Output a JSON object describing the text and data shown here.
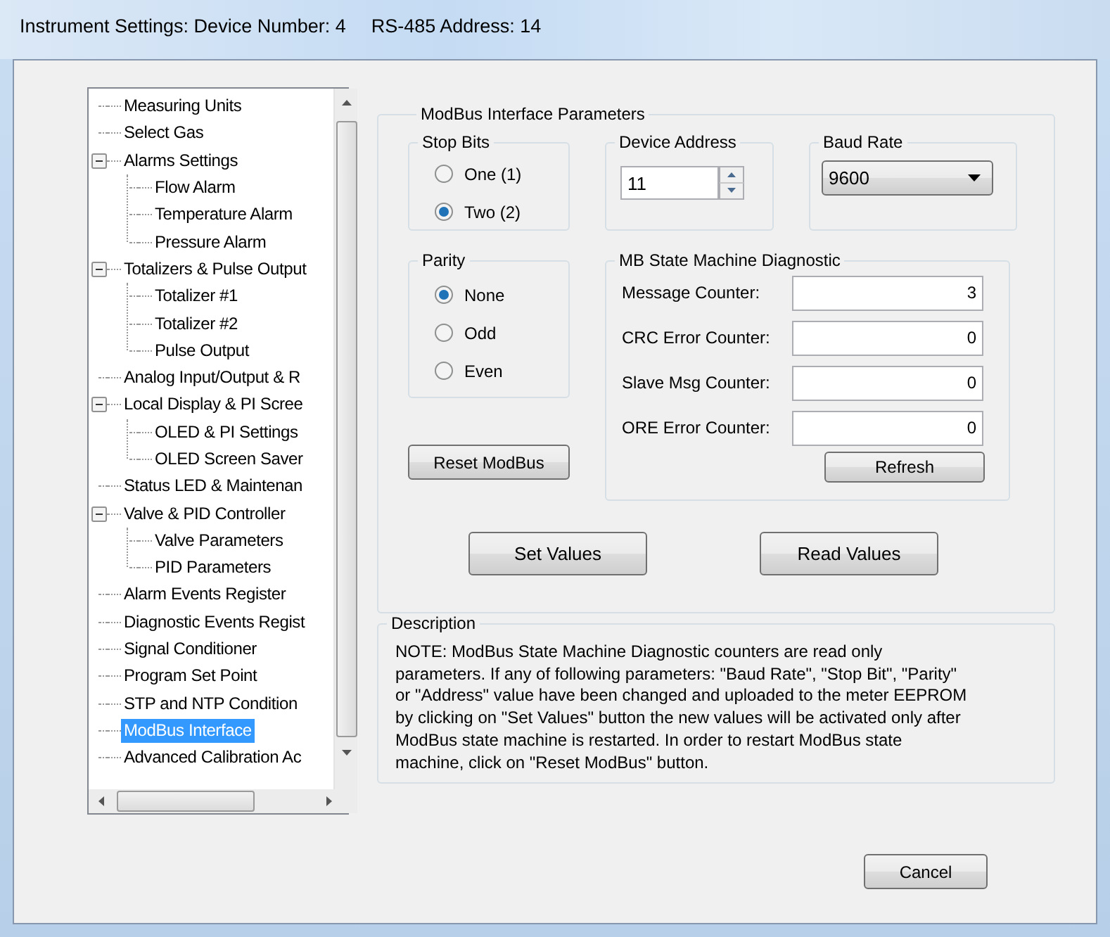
{
  "window": {
    "title_parts": [
      "Instrument Settings: Device Number: 4",
      "RS-485 Address: 14"
    ]
  },
  "tree": [
    {
      "label": "Measuring Units",
      "selected": false
    },
    {
      "label": "Select Gas",
      "selected": false
    },
    {
      "label": "Alarms Settings",
      "selected": false,
      "expanded": true,
      "children": [
        {
          "label": "Flow Alarm",
          "selected": false
        },
        {
          "label": "Temperature Alarm",
          "selected": false
        },
        {
          "label": "Pressure Alarm",
          "selected": false
        }
      ]
    },
    {
      "label": "Totalizers & Pulse Output",
      "selected": false,
      "expanded": true,
      "children": [
        {
          "label": "Totalizer #1",
          "selected": false
        },
        {
          "label": "Totalizer #2",
          "selected": false
        },
        {
          "label": "Pulse Output",
          "selected": false
        }
      ]
    },
    {
      "label": "Analog Input/Output & R",
      "selected": false
    },
    {
      "label": "Local Display & PI Scree",
      "selected": false,
      "expanded": true,
      "children": [
        {
          "label": "OLED & PI Settings",
          "selected": false
        },
        {
          "label": "OLED Screen Saver",
          "selected": false
        }
      ]
    },
    {
      "label": "Status LED & Maintenan",
      "selected": false
    },
    {
      "label": "Valve & PID Controller",
      "selected": false,
      "expanded": true,
      "children": [
        {
          "label": "Valve Parameters",
          "selected": false
        },
        {
          "label": "PID Parameters",
          "selected": false
        }
      ]
    },
    {
      "label": "Alarm Events Register",
      "selected": false
    },
    {
      "label": "Diagnostic Events Regist",
      "selected": false
    },
    {
      "label": "Signal Conditioner",
      "selected": false
    },
    {
      "label": "Program Set Point",
      "selected": false
    },
    {
      "label": "STP and NTP Condition",
      "selected": false
    },
    {
      "label": "ModBus Interface",
      "selected": true
    },
    {
      "label": "Advanced Calibration Ac",
      "selected": false
    }
  ],
  "modbus": {
    "title": "ModBus Interface Parameters",
    "stop_bits": {
      "title": "Stop Bits",
      "options": [
        {
          "label": "One (1)",
          "selected": false
        },
        {
          "label": "Two (2)",
          "selected": true
        }
      ]
    },
    "device_address": {
      "title": "Device Address",
      "value": "11"
    },
    "baud_rate": {
      "title": "Baud Rate",
      "value": "9600"
    },
    "parity": {
      "title": "Parity",
      "options": [
        {
          "label": "None",
          "selected": true
        },
        {
          "label": "Odd",
          "selected": false
        },
        {
          "label": "Even",
          "selected": false
        }
      ]
    },
    "reset_button": "Reset ModBus",
    "diagnostic": {
      "title": "MB State Machine Diagnostic",
      "counters": [
        {
          "label": "Message Counter:",
          "value": "3"
        },
        {
          "label": "CRC Error Counter:",
          "value": "0"
        },
        {
          "label": "Slave Msg Counter:",
          "value": "0"
        },
        {
          "label": "ORE Error Counter:",
          "value": "0"
        }
      ],
      "refresh_button": "Refresh"
    },
    "set_button": "Set Values",
    "read_button": "Read Values"
  },
  "description": {
    "title": "Description",
    "text": "NOTE: ModBus State Machine Diagnostic counters are read only parameters. If any of following parameters: \"Baud Rate\", \"Stop Bit\", \"Parity\" or \"Address\" value have been changed and uploaded to the meter EEPROM by clicking on \"Set Values\" button the new values will be activated only after ModBus state machine is restarted. In order to restart ModBus state machine, click on \"Reset ModBus\" button."
  },
  "cancel_button": "Cancel"
}
